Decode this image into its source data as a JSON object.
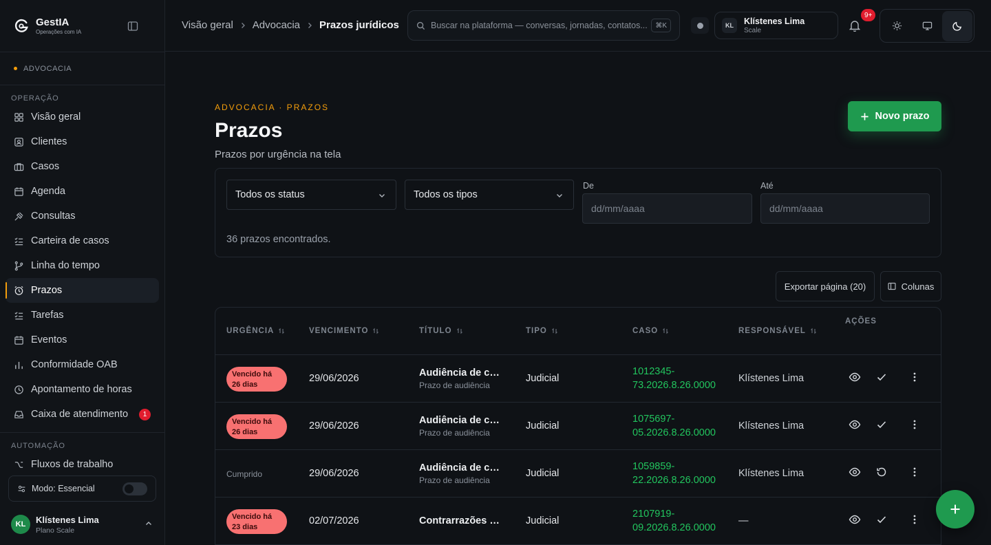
{
  "brand": {
    "name": "GestIA",
    "subtitle": "Operações com IA"
  },
  "area": {
    "label": "ADVOCACIA"
  },
  "sidebar": {
    "sections": [
      {
        "title": "OPERAÇÃO"
      },
      {
        "title": "AUTOMAÇÃO"
      }
    ],
    "items": [
      {
        "label": "Visão geral",
        "icon": "grid-icon"
      },
      {
        "label": "Clientes",
        "icon": "contact-icon"
      },
      {
        "label": "Casos",
        "icon": "briefcase-icon"
      },
      {
        "label": "Agenda",
        "icon": "calendar-icon"
      },
      {
        "label": "Consultas",
        "icon": "gavel-icon"
      },
      {
        "label": "Carteira de casos",
        "icon": "list-check-icon"
      },
      {
        "label": "Linha do tempo",
        "icon": "branch-icon"
      },
      {
        "label": "Prazos",
        "icon": "alarm-icon"
      },
      {
        "label": "Tarefas",
        "icon": "list-check-icon"
      },
      {
        "label": "Eventos",
        "icon": "calendar-icon"
      },
      {
        "label": "Conformidade OAB",
        "icon": "bar-chart-icon"
      },
      {
        "label": "Apontamento de horas",
        "icon": "clock-icon"
      },
      {
        "label": "Caixa de atendimento",
        "icon": "inbox-icon",
        "badge": "1"
      },
      {
        "label": "Fluxos de trabalho",
        "icon": "workflow-icon"
      }
    ],
    "mode_label": "Modo: Essencial",
    "user": {
      "initials": "KL",
      "name": "Klístenes Lima",
      "plan": "Plano Scale"
    }
  },
  "topbar": {
    "breadcrumbs": [
      "Visão geral",
      "Advocacia",
      "Prazos jurídicos"
    ],
    "search_placeholder": "Buscar na plataforma — conversas, jornadas, contatos...",
    "search_shortcut": "⌘K",
    "account": {
      "initials": "KL",
      "name": "Klístenes Lima",
      "plan": "Scale"
    },
    "notifications_badge": "9+"
  },
  "page": {
    "eyebrow": "ADVOCACIA · PRAZOS",
    "title": "Prazos",
    "subtitle": "Prazos por urgência na tela",
    "new_button": "Novo prazo"
  },
  "filters": {
    "status_value": "Todos os status",
    "type_value": "Todos os tipos",
    "from_label": "De",
    "to_label": "Até",
    "from_placeholder": "dd/mm/aaaa",
    "to_placeholder": "dd/mm/aaaa",
    "count_text": "36 prazos encontrados."
  },
  "toolbar": {
    "export_label": "Exportar página (20)",
    "columns_label": "Colunas"
  },
  "table": {
    "headers": [
      "URGÊNCIA",
      "VENCIMENTO",
      "TÍTULO",
      "TIPO",
      "CASO",
      "RESPONSÁVEL",
      "AÇÕES"
    ],
    "rows": [
      {
        "urgency": "Vencido há 26 dias",
        "urgency_kind": "overdue",
        "due": "29/06/2026",
        "title": "Audiência de conciliação",
        "title_sub": "Prazo de audiência",
        "type": "Judicial",
        "case_l1": "1012345-",
        "case_l2": "73.2026.8.26.0000",
        "responsible": "Klístenes Lima",
        "action": "check"
      },
      {
        "urgency": "Vencido há 26 dias",
        "urgency_kind": "overdue",
        "due": "29/06/2026",
        "title": "Audiência de conciliação",
        "title_sub": "Prazo de audiência",
        "type": "Judicial",
        "case_l1": "1075697-",
        "case_l2": "05.2026.8.26.0000",
        "responsible": "Klístenes Lima",
        "action": "check"
      },
      {
        "urgency": "Cumprido",
        "urgency_kind": "done",
        "due": "29/06/2026",
        "title": "Audiência de conciliação",
        "title_sub": "Prazo de audiência",
        "type": "Judicial",
        "case_l1": "1059859-",
        "case_l2": "22.2026.8.26.0000",
        "responsible": "Klístenes Lima",
        "action": "undo"
      },
      {
        "urgency": "Vencido há 23 dias",
        "urgency_kind": "overdue",
        "due": "02/07/2026",
        "title": "Contrarrazões de apelação",
        "title_sub": "",
        "type": "Judicial",
        "case_l1": "2107919-",
        "case_l2": "09.2026.8.26.0000",
        "responsible": "—",
        "action": "check"
      }
    ]
  },
  "colors": {
    "accent": "#f59e0b",
    "primary": "#1f9a4f",
    "case_link": "#22c55e",
    "overdue_badge": "#f87171"
  }
}
